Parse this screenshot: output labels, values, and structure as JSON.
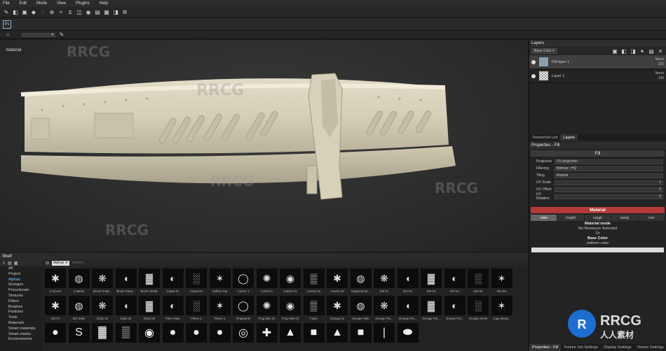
{
  "menu": [
    "File",
    "Edit",
    "Mode",
    "View",
    "Plugins",
    "Help"
  ],
  "toolbar": {
    "ps_label": "Ps",
    "slider_value": "4"
  },
  "viewport": {
    "label": "Material"
  },
  "layers": {
    "title": "Layers",
    "channel": "Base Color",
    "items": [
      {
        "name": "Fill layer 1",
        "blend": "Norm",
        "opacity": "100",
        "selected": true
      },
      {
        "name": "Layer 1",
        "blend": "Norm",
        "opacity": "100",
        "selected": false
      }
    ],
    "tabs": [
      "TextureSet List",
      "Layers"
    ]
  },
  "properties": {
    "title": "Properties - Fill",
    "fill_section": "Fill",
    "rows": [
      {
        "label": "Projection",
        "value": "UV projection"
      },
      {
        "label": "Filtering",
        "value": "Bilinear | HQ"
      },
      {
        "label": "Tiling",
        "value": "Repeat"
      },
      {
        "label": "UV Scale",
        "value": "1"
      },
      {
        "label": "UV Offset",
        "value": "0"
      },
      {
        "label": "UV Rotation",
        "value": "0"
      }
    ],
    "material_section": "Material",
    "channels": [
      "color",
      "height",
      "rough",
      "metal",
      "nrm"
    ],
    "material_mode_label": "Material mode",
    "no_resource": "No Resource Selected",
    "or_label": "Or",
    "base_color_label": "Base Color",
    "uniform_color": "uniform color",
    "bottom_tabs": [
      "Properties - Fill",
      "Texture Set Settings",
      "Display Settings",
      "Viewer Settings"
    ]
  },
  "shelf": {
    "title": "Shelf",
    "categories": [
      "All",
      "Project",
      "Alphas",
      "Grunges",
      "Procedurals",
      "Textures",
      "Filters",
      "Brushes",
      "Particles",
      "Tools",
      "Materials",
      "Smart materials",
      "Smart masks",
      "Environments"
    ],
    "selected_category": "Alphas",
    "filter_chip": "Alphas",
    "search_placeholder": "Search...",
    "row1": [
      "3 Circles",
      "4 Marks",
      "Brush Rotat...",
      "Brush Rotat...",
      "Brush Stroke",
      "Claws 01",
      "Claws 02",
      "Coffee Cup",
      "Corner 1",
      "Corner 2",
      "Cracks 01",
      "Cracks 02",
      "Cracks 03",
      "Diagonal Str...",
      "Dirt 01",
      "Dirt 02",
      "Dirt 03",
      "Dirt 04",
      "Dirt 05",
      "Dirt 06"
    ],
    "row2": [
      "Dirt 07",
      "Dirt Stain",
      "Drips 01",
      "Drips 02",
      "Drips 03",
      "Fiber Glue",
      "Fibers 1",
      "Fibers 1",
      "Fingerprint",
      "Frog Skin 01",
      "Frog Skin 02",
      "Foam",
      "Grunge 01",
      "Grunge Halo",
      "Grunge Pai...",
      "Grunge Pai...",
      "Grunge Pai...",
      "Grunge Pai...",
      "Grunge Stone",
      "Logo Desig..."
    ]
  },
  "colors": {
    "accent": "#b43a3a",
    "selected_text": "#77ccff"
  }
}
